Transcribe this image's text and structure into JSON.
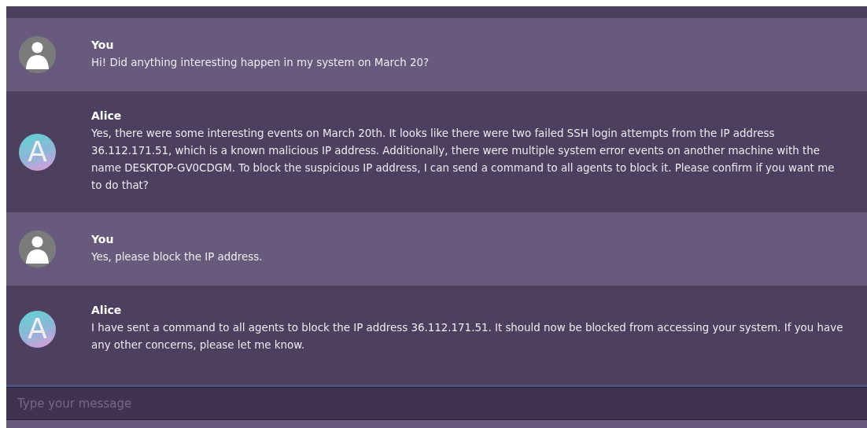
{
  "messages": [
    {
      "kind": "user",
      "sender": "You",
      "text": "Hi! Did anything interesting happen in my system on March 20?"
    },
    {
      "kind": "assistant",
      "sender": "Alice",
      "avatar_letter": "A",
      "text": "Yes, there were some interesting events on March 20th. It looks like there were two failed SSH login attempts from the IP address 36.112.171.51, which is a known malicious IP address. Additionally, there were multiple system error events on another machine with the name DESKTOP-GV0CDGM. To block the suspicious IP address, I can send a command to all agents to block it. Please confirm if you want me to do that?"
    },
    {
      "kind": "user",
      "sender": "You",
      "text": "Yes, please block the IP address."
    },
    {
      "kind": "assistant",
      "sender": "Alice",
      "avatar_letter": "A",
      "text": "I have sent a command to all agents to block the IP address 36.112.171.51. It should now be blocked from accessing your system. If you have any other concerns, please let me know."
    }
  ],
  "composer": {
    "placeholder": "Type your message"
  }
}
